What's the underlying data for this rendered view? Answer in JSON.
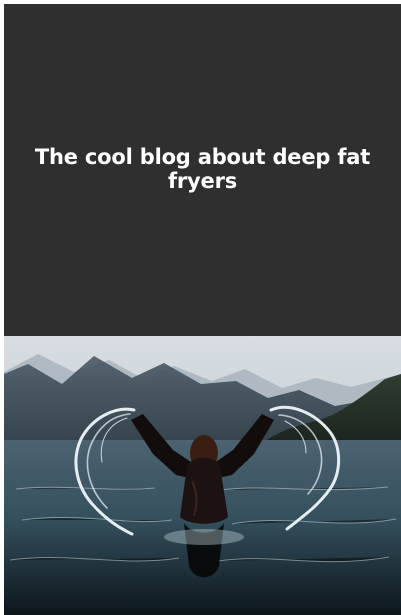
{
  "blog": {
    "title": "The cool blog about deep fat fryers"
  },
  "hero_image": {
    "icon": "lake-swimmer-image"
  },
  "colors": {
    "cover_background": "#2f2f2f",
    "title_text": "#ffffff",
    "page_background": "#ffffff"
  }
}
